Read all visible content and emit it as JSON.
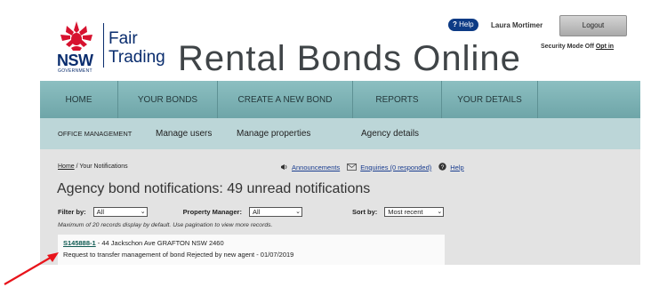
{
  "header": {
    "logo_nsw": "NSW",
    "logo_government": "GOVERNMENT",
    "logo_line1": "Fair",
    "logo_line2": "Trading",
    "site_title": "Rental Bonds Online",
    "help_label": "Help",
    "user_name": "Laura Mortimer",
    "logout_label": "Logout",
    "security_mode": "Security Mode Off",
    "opt_in": "Opt in"
  },
  "main_nav": [
    {
      "label": "HOME"
    },
    {
      "label": "YOUR BONDS"
    },
    {
      "label": "CREATE A NEW BOND"
    },
    {
      "label": "REPORTS"
    },
    {
      "label": "YOUR DETAILS"
    }
  ],
  "sub_nav": {
    "office": "OFFICE MANAGEMENT",
    "items": [
      {
        "label": "Manage users"
      },
      {
        "label": "Manage properties"
      },
      {
        "label": "Agency details"
      }
    ]
  },
  "breadcrumb": {
    "home": "Home",
    "separator": " / ",
    "current": "Your Notifications"
  },
  "links": {
    "announcements": "Announcements",
    "enquiries": "Enquiries (0 responded)",
    "help": "Help"
  },
  "page_title": "Agency bond notifications: 49 unread notifications",
  "filters": {
    "filter_by_label": "Filter by:",
    "filter_by_value": "All",
    "property_manager_label": "Property Manager:",
    "property_manager_value": "All",
    "sort_by_label": "Sort by:",
    "sort_by_value": "Most recent"
  },
  "note": "Maximum of 20 records display by default. Use pagination to view more records.",
  "notifications": [
    {
      "bond_id": "S145888-1",
      "address": " - 44 Jackschon Ave GRAFTON NSW 2460",
      "message": "Request to transfer management of bond Rejected by new agent - 01/07/2019"
    }
  ],
  "colors": {
    "nav": "#7fb3b5",
    "sub_nav": "#bcd6d8",
    "content_bg": "#e3e3e3",
    "brand_navy": "#0a2d6e",
    "waratah_red": "#d7122f",
    "annotation_arrow": "#e8141b"
  }
}
